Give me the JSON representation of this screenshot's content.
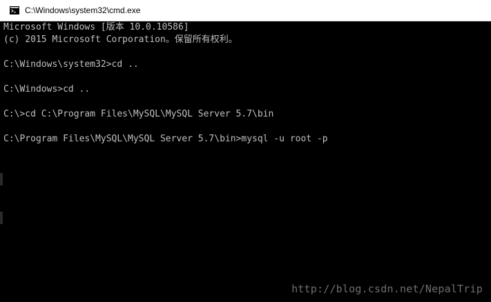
{
  "window": {
    "title": "C:\\Windows\\system32\\cmd.exe",
    "icon": "console-icon"
  },
  "console": {
    "lines": [
      "Microsoft Windows [版本 10.0.10586]",
      "(c) 2015 Microsoft Corporation。保留所有权利。",
      "",
      "C:\\Windows\\system32>cd ..",
      "",
      "C:\\Windows>cd ..",
      "",
      "C:\\>cd C:\\Program Files\\MySQL\\MySQL Server 5.7\\bin",
      "",
      "C:\\Program Files\\MySQL\\MySQL Server 5.7\\bin>mysql -u root -p"
    ]
  },
  "watermark": "http://blog.csdn.net/NepalTrip",
  "colors": {
    "background": "#000000",
    "text": "#c0c0c0",
    "titlebar": "#ffffff"
  }
}
